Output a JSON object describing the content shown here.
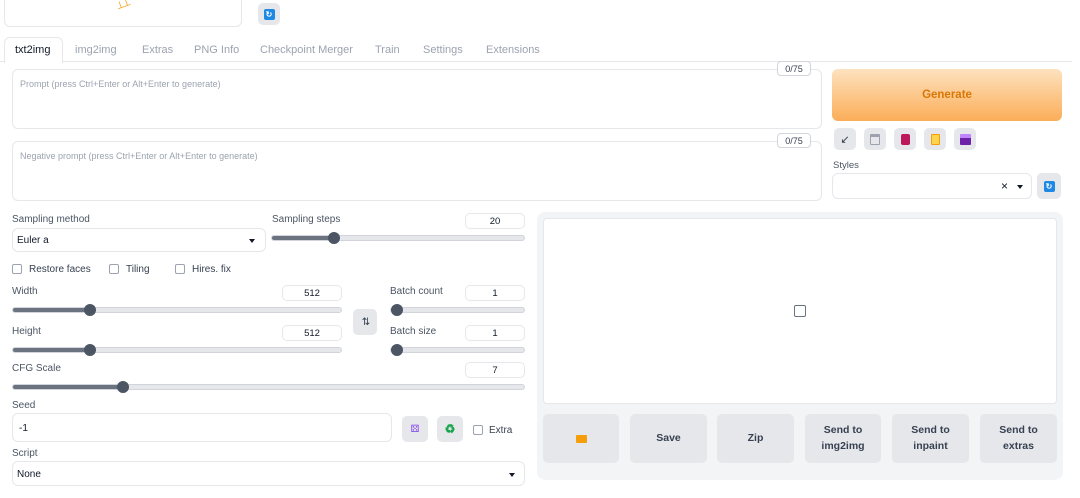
{
  "tabs": [
    "txt2img",
    "img2img",
    "Extras",
    "PNG Info",
    "Checkpoint Merger",
    "Train",
    "Settings",
    "Extensions"
  ],
  "prompt": {
    "placeholder": "Prompt (press Ctrl+Enter or Alt+Enter to generate)",
    "counter": "0/75"
  },
  "negative_prompt": {
    "placeholder": "Negative prompt (press Ctrl+Enter or Alt+Enter to generate)",
    "counter": "0/75"
  },
  "generate_label": "Generate",
  "styles": {
    "label": "Styles",
    "clear": "×"
  },
  "sampling": {
    "method_label": "Sampling method",
    "method_value": "Euler a",
    "steps_label": "Sampling steps",
    "steps_value": "20",
    "steps_fraction": 0.245
  },
  "options": {
    "restore_faces": "Restore faces",
    "tiling": "Tiling",
    "hires_fix": "Hires. fix"
  },
  "width": {
    "label": "Width",
    "value": "512",
    "fraction": 0.235
  },
  "height": {
    "label": "Height",
    "value": "512",
    "fraction": 0.235
  },
  "batch_count": {
    "label": "Batch count",
    "value": "1",
    "fraction": 0.0
  },
  "batch_size": {
    "label": "Batch size",
    "value": "1",
    "fraction": 0.0
  },
  "cfg": {
    "label": "CFG Scale",
    "value": "7",
    "fraction": 0.215
  },
  "seed": {
    "label": "Seed",
    "value": "-1",
    "extra_label": "Extra"
  },
  "script": {
    "label": "Script",
    "value": "None"
  },
  "output_buttons": {
    "save": "Save",
    "zip": "Zip",
    "send_img2img": "Send to\nimg2img",
    "send_inpaint": "Send to\ninpaint",
    "send_extras": "Send to\nextras"
  },
  "icons": {
    "refresh": "refresh-icon",
    "swap": "swap-icon",
    "dice": "dice-icon",
    "recycle": "recycle-icon",
    "folder": "folder-icon",
    "image_placeholder": "image-icon"
  },
  "colors": {
    "generate_from": "#fdd9a8",
    "generate_to": "#fba94b",
    "generate_text": "#d97706",
    "refresh_blue": "#1e88e5"
  }
}
